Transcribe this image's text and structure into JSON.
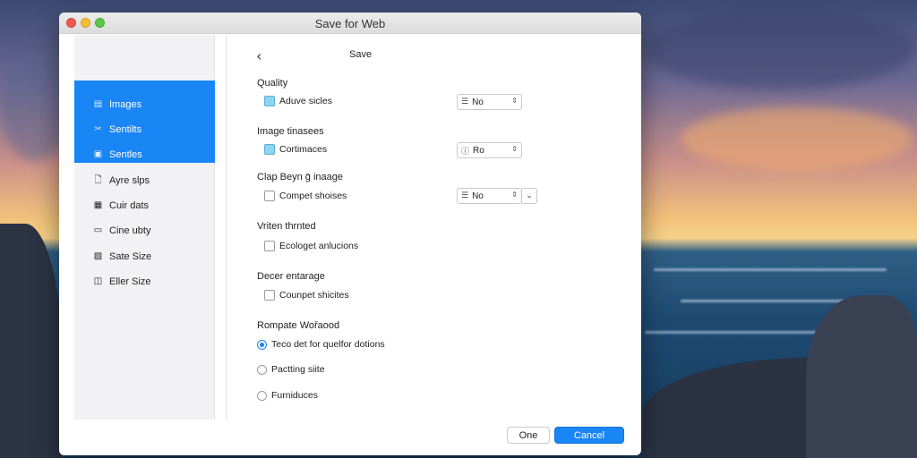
{
  "window": {
    "title": "Save for Web"
  },
  "sidebar": {
    "items": [
      {
        "label": "Images",
        "icon": "image-list-icon",
        "active": true
      },
      {
        "label": "Sentilts",
        "icon": "scissors-icon",
        "active": true
      },
      {
        "label": "Sentles",
        "icon": "frames-icon",
        "active": true
      },
      {
        "label": "Ayre slps",
        "icon": "document-icon",
        "active": false
      },
      {
        "label": "Cuir dats",
        "icon": "table-icon",
        "active": false
      },
      {
        "label": "Cine ubty",
        "icon": "display-icon",
        "active": false
      },
      {
        "label": "Sate Size",
        "icon": "image-size-icon",
        "active": false
      },
      {
        "label": "Eller Size",
        "icon": "panel-icon",
        "active": false
      }
    ]
  },
  "content": {
    "back_glyph": "‹",
    "title": "Save",
    "sections": [
      {
        "label": "Quality",
        "option": "Aduve sicles",
        "checked": true,
        "select": {
          "icon": "☰",
          "value": "No",
          "arrows": "⇕"
        }
      },
      {
        "label": "Image tinasees",
        "option": "Cortimaces",
        "checked": true,
        "select": {
          "icon": "ⓘ",
          "value": "Ro",
          "arrows": "⇕"
        }
      },
      {
        "label": "Clap Beyn ḡ inaage",
        "option": "Compet shoises",
        "checked": false,
        "select": {
          "icon": "☰",
          "value": "No",
          "arrows": "⇕",
          "chevron": "⌄"
        }
      },
      {
        "label": "Vriten thrnted",
        "option": "Ecologet anlucions",
        "checked": false
      },
      {
        "label": "Decer entarage",
        "option": "Counpet shicites",
        "checked": false
      }
    ],
    "radio_group": {
      "label": "Rompate Wořaood",
      "options": [
        {
          "label": "Teco det for quelfor dotions",
          "selected": true
        },
        {
          "label": "Pactting siite",
          "selected": false
        },
        {
          "label": "Furniduces",
          "selected": false
        }
      ]
    }
  },
  "footer": {
    "one_label": "One",
    "cancel_label": "Cancel"
  },
  "colors": {
    "accent": "#1a85f5",
    "checkbox_checked": "#8fd4f0"
  }
}
